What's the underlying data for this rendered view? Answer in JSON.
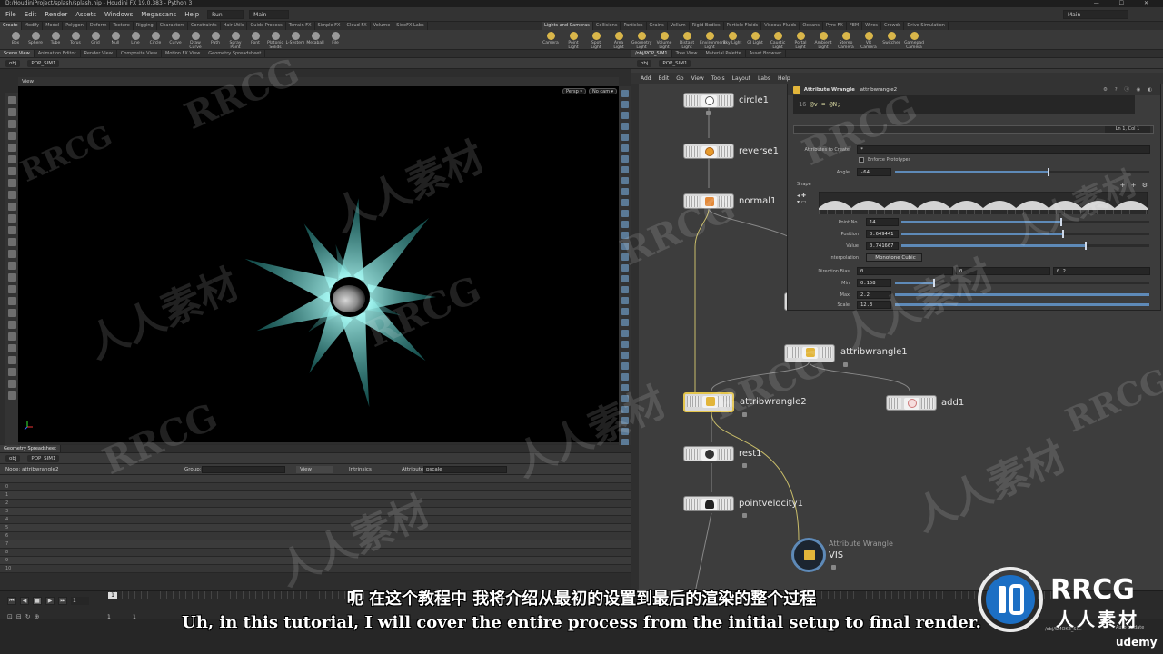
{
  "window": {
    "title": "D:/HoudiniProject/splash/splash.hip - Houdini FX 19.0.383 - Python 3",
    "controls": "— ☐ ✕"
  },
  "menubar": {
    "items": [
      "File",
      "Edit",
      "Render",
      "Assets",
      "Windows",
      "Megascans",
      "Help"
    ],
    "run_dropdown": "Run",
    "desktop_dropdown": "Main",
    "right_dropdown": "Main"
  },
  "shelf_tabs": {
    "left": [
      "Create",
      "Modify",
      "Model",
      "Polygon",
      "Deform",
      "Texture",
      "Rigging",
      "Characters",
      "Constraints",
      "Hair Utils",
      "Guide Process",
      "Terrain FX",
      "Simple FX",
      "Cloud FX",
      "Volume",
      "SideFX Labs"
    ],
    "right": [
      "Lights and Cameras",
      "Collisions",
      "Particles",
      "Grains",
      "Vellum",
      "Rigid Bodies",
      "Particle Fluids",
      "Viscous Fluids",
      "Oceans",
      "Pyro FX",
      "FEM",
      "Wires",
      "Crowds",
      "Drive Simulation"
    ]
  },
  "shelf_tools": {
    "left": [
      "Box",
      "Sphere",
      "Tube",
      "Torus",
      "Grid",
      "Null",
      "Line",
      "Circle",
      "Curve",
      "Draw Curve",
      "Path",
      "Spray Paint",
      "Font",
      "Platonic Solids",
      "L-System",
      "Metaball",
      "File"
    ],
    "right": [
      "Camera",
      "Point Light",
      "Spot Light",
      "Area Light",
      "Geometry Light",
      "Volume Light",
      "Distant Light",
      "Environment Light",
      "Sky Light",
      "GI Light",
      "Caustic Light",
      "Portal Light",
      "Ambient Light",
      "Stereo Camera",
      "VR Camera",
      "Switcher",
      "Gamepad Camera"
    ]
  },
  "left_tabs": [
    "Scene View",
    "Animation Editor",
    "Render View",
    "Composite View",
    "Motion FX View",
    "Geometry Spreadsheet"
  ],
  "left_path": [
    "obj",
    "POP_SIM1"
  ],
  "viewport": {
    "label": "View",
    "persp": "Persp ▾",
    "cam": "No cam ▾"
  },
  "spreadsheet": {
    "tab": "Geometry Spreadsheet",
    "path": [
      "obj",
      "POP_SIM1"
    ],
    "node_label": "Node: attribwrangle2",
    "group_label": "Group:",
    "view_label": "View",
    "intrinsic_label": "Intrinsics",
    "attributes_label": "Attributes:",
    "attributes_value": "pscale",
    "row_numbers": [
      "0",
      "1",
      "2",
      "3",
      "4",
      "5",
      "6",
      "7",
      "8",
      "9",
      "10"
    ]
  },
  "playbar": {
    "frame": "1",
    "start": "1",
    "end": "1",
    "frame_marker": "1"
  },
  "right_tabs": [
    "/obj/POP_SIM1",
    "Tree View",
    "Material Palette",
    "Asset Browser"
  ],
  "right_path": [
    "obj",
    "POP_SIM1"
  ],
  "network_menu": [
    "Add",
    "Edit",
    "Go",
    "View",
    "Tools",
    "Layout",
    "Labs",
    "Help"
  ],
  "param_panel": {
    "type_label": "Attribute Wrangle",
    "node_name": "attribwrangle2",
    "code_line_number": "16",
    "code": "@v = @N;",
    "cursor_pos": "Ln 1, Col 1",
    "attributes_to_create_label": "Attributes to Create",
    "attributes_to_create_value": "*",
    "enforce_prototypes": "Enforce Prototypes",
    "angle_label": "Angle",
    "angle_value": "-64",
    "angle_fraction": 0.6,
    "shape_label": "Shape",
    "point_no_label": "Point No.",
    "point_no_value": "14",
    "point_no_fraction": 0.64,
    "position_label": "Position",
    "position_value": "0.649441",
    "position_fraction": 0.649441,
    "value_label": "Value",
    "value_value": "0.741667",
    "value_fraction": 0.741667,
    "interpolation_label": "Interpolation",
    "interpolation_value": "Monotone Cubic",
    "direction_bias_label": "Direction Bias",
    "direction_bias_values": [
      "0",
      "0",
      "0.2"
    ],
    "min_label": "Min",
    "min_value": "0.158",
    "max_label": "Max",
    "max_value": "2.2",
    "scale_label": "Scale",
    "scale_value": "12.3"
  },
  "network_nodes": {
    "circle": "circle1",
    "reverse": "reverse1",
    "normal": "normal1",
    "wrangle1": "attribwrangle1",
    "wrangle2": "attribwrangle2",
    "add": "add1",
    "rest": "rest1",
    "pointvelocity": "pointvelocity1",
    "vis_type": "Attribute Wrangle",
    "vis": "VIS"
  },
  "status": {
    "path": "/obj/SMOKE_SI...",
    "auto_update": "Auto Update"
  },
  "subtitles": {
    "cn": "呃 在这个教程中 我将介绍从最初的设置到最后的渲染的整个过程",
    "en": "Uh, in this tutorial, I will cover the entire process from the initial setup to final render."
  },
  "branding": {
    "logo": "RRCG",
    "logo_sub": "人人素材",
    "udemy": "udemy",
    "watermark_en": "RRCG",
    "watermark_cn": "人人素材"
  },
  "colors": {
    "accent_blue": "#5e8ab8",
    "selected_node": "#e3c44b",
    "particle_cyan": "#3fd6d0"
  }
}
